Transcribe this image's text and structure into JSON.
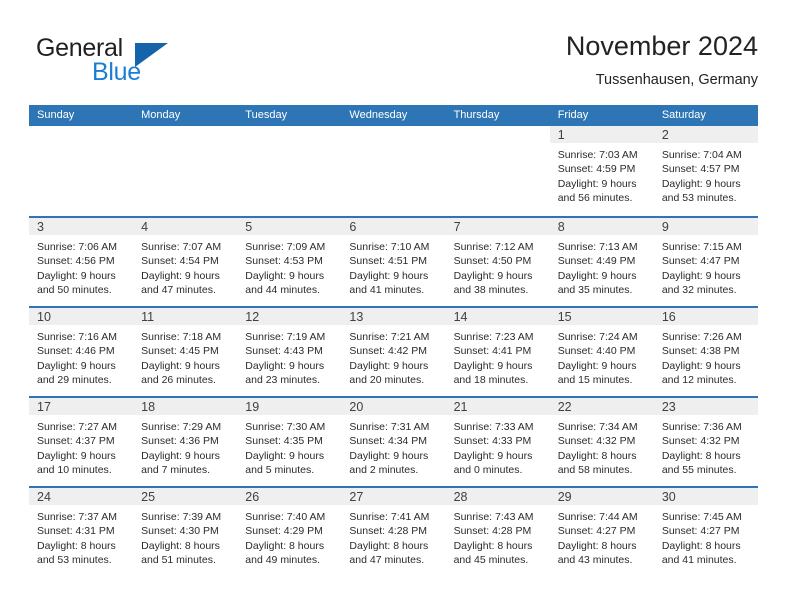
{
  "brand": {
    "word_general": "General",
    "word_blue": "Blue",
    "triangle_color": "#1464AB",
    "blue_text_color": "#1A7FD4"
  },
  "header": {
    "title": "November 2024",
    "subtitle": "Tussenhausen, Germany"
  },
  "theme": {
    "header_bg": "#2E75B6",
    "header_text": "#FFFFFF",
    "date_band_bg": "#EFEFEF",
    "row_divider": "#2E75B6",
    "body_text": "#2B2B2B"
  },
  "weekdays": [
    "Sunday",
    "Monday",
    "Tuesday",
    "Wednesday",
    "Thursday",
    "Friday",
    "Saturday"
  ],
  "weeks": [
    [
      {
        "empty": true
      },
      {
        "empty": true
      },
      {
        "empty": true
      },
      {
        "empty": true
      },
      {
        "empty": true
      },
      {
        "day": "1",
        "sunrise": "Sunrise: 7:03 AM",
        "sunset": "Sunset: 4:59 PM",
        "daylight1": "Daylight: 9 hours",
        "daylight2": "and 56 minutes."
      },
      {
        "day": "2",
        "sunrise": "Sunrise: 7:04 AM",
        "sunset": "Sunset: 4:57 PM",
        "daylight1": "Daylight: 9 hours",
        "daylight2": "and 53 minutes."
      }
    ],
    [
      {
        "day": "3",
        "sunrise": "Sunrise: 7:06 AM",
        "sunset": "Sunset: 4:56 PM",
        "daylight1": "Daylight: 9 hours",
        "daylight2": "and 50 minutes."
      },
      {
        "day": "4",
        "sunrise": "Sunrise: 7:07 AM",
        "sunset": "Sunset: 4:54 PM",
        "daylight1": "Daylight: 9 hours",
        "daylight2": "and 47 minutes."
      },
      {
        "day": "5",
        "sunrise": "Sunrise: 7:09 AM",
        "sunset": "Sunset: 4:53 PM",
        "daylight1": "Daylight: 9 hours",
        "daylight2": "and 44 minutes."
      },
      {
        "day": "6",
        "sunrise": "Sunrise: 7:10 AM",
        "sunset": "Sunset: 4:51 PM",
        "daylight1": "Daylight: 9 hours",
        "daylight2": "and 41 minutes."
      },
      {
        "day": "7",
        "sunrise": "Sunrise: 7:12 AM",
        "sunset": "Sunset: 4:50 PM",
        "daylight1": "Daylight: 9 hours",
        "daylight2": "and 38 minutes."
      },
      {
        "day": "8",
        "sunrise": "Sunrise: 7:13 AM",
        "sunset": "Sunset: 4:49 PM",
        "daylight1": "Daylight: 9 hours",
        "daylight2": "and 35 minutes."
      },
      {
        "day": "9",
        "sunrise": "Sunrise: 7:15 AM",
        "sunset": "Sunset: 4:47 PM",
        "daylight1": "Daylight: 9 hours",
        "daylight2": "and 32 minutes."
      }
    ],
    [
      {
        "day": "10",
        "sunrise": "Sunrise: 7:16 AM",
        "sunset": "Sunset: 4:46 PM",
        "daylight1": "Daylight: 9 hours",
        "daylight2": "and 29 minutes."
      },
      {
        "day": "11",
        "sunrise": "Sunrise: 7:18 AM",
        "sunset": "Sunset: 4:45 PM",
        "daylight1": "Daylight: 9 hours",
        "daylight2": "and 26 minutes."
      },
      {
        "day": "12",
        "sunrise": "Sunrise: 7:19 AM",
        "sunset": "Sunset: 4:43 PM",
        "daylight1": "Daylight: 9 hours",
        "daylight2": "and 23 minutes."
      },
      {
        "day": "13",
        "sunrise": "Sunrise: 7:21 AM",
        "sunset": "Sunset: 4:42 PM",
        "daylight1": "Daylight: 9 hours",
        "daylight2": "and 20 minutes."
      },
      {
        "day": "14",
        "sunrise": "Sunrise: 7:23 AM",
        "sunset": "Sunset: 4:41 PM",
        "daylight1": "Daylight: 9 hours",
        "daylight2": "and 18 minutes."
      },
      {
        "day": "15",
        "sunrise": "Sunrise: 7:24 AM",
        "sunset": "Sunset: 4:40 PM",
        "daylight1": "Daylight: 9 hours",
        "daylight2": "and 15 minutes."
      },
      {
        "day": "16",
        "sunrise": "Sunrise: 7:26 AM",
        "sunset": "Sunset: 4:38 PM",
        "daylight1": "Daylight: 9 hours",
        "daylight2": "and 12 minutes."
      }
    ],
    [
      {
        "day": "17",
        "sunrise": "Sunrise: 7:27 AM",
        "sunset": "Sunset: 4:37 PM",
        "daylight1": "Daylight: 9 hours",
        "daylight2": "and 10 minutes."
      },
      {
        "day": "18",
        "sunrise": "Sunrise: 7:29 AM",
        "sunset": "Sunset: 4:36 PM",
        "daylight1": "Daylight: 9 hours",
        "daylight2": "and 7 minutes."
      },
      {
        "day": "19",
        "sunrise": "Sunrise: 7:30 AM",
        "sunset": "Sunset: 4:35 PM",
        "daylight1": "Daylight: 9 hours",
        "daylight2": "and 5 minutes."
      },
      {
        "day": "20",
        "sunrise": "Sunrise: 7:31 AM",
        "sunset": "Sunset: 4:34 PM",
        "daylight1": "Daylight: 9 hours",
        "daylight2": "and 2 minutes."
      },
      {
        "day": "21",
        "sunrise": "Sunrise: 7:33 AM",
        "sunset": "Sunset: 4:33 PM",
        "daylight1": "Daylight: 9 hours",
        "daylight2": "and 0 minutes."
      },
      {
        "day": "22",
        "sunrise": "Sunrise: 7:34 AM",
        "sunset": "Sunset: 4:32 PM",
        "daylight1": "Daylight: 8 hours",
        "daylight2": "and 58 minutes."
      },
      {
        "day": "23",
        "sunrise": "Sunrise: 7:36 AM",
        "sunset": "Sunset: 4:32 PM",
        "daylight1": "Daylight: 8 hours",
        "daylight2": "and 55 minutes."
      }
    ],
    [
      {
        "day": "24",
        "sunrise": "Sunrise: 7:37 AM",
        "sunset": "Sunset: 4:31 PM",
        "daylight1": "Daylight: 8 hours",
        "daylight2": "and 53 minutes."
      },
      {
        "day": "25",
        "sunrise": "Sunrise: 7:39 AM",
        "sunset": "Sunset: 4:30 PM",
        "daylight1": "Daylight: 8 hours",
        "daylight2": "and 51 minutes."
      },
      {
        "day": "26",
        "sunrise": "Sunrise: 7:40 AM",
        "sunset": "Sunset: 4:29 PM",
        "daylight1": "Daylight: 8 hours",
        "daylight2": "and 49 minutes."
      },
      {
        "day": "27",
        "sunrise": "Sunrise: 7:41 AM",
        "sunset": "Sunset: 4:28 PM",
        "daylight1": "Daylight: 8 hours",
        "daylight2": "and 47 minutes."
      },
      {
        "day": "28",
        "sunrise": "Sunrise: 7:43 AM",
        "sunset": "Sunset: 4:28 PM",
        "daylight1": "Daylight: 8 hours",
        "daylight2": "and 45 minutes."
      },
      {
        "day": "29",
        "sunrise": "Sunrise: 7:44 AM",
        "sunset": "Sunset: 4:27 PM",
        "daylight1": "Daylight: 8 hours",
        "daylight2": "and 43 minutes."
      },
      {
        "day": "30",
        "sunrise": "Sunrise: 7:45 AM",
        "sunset": "Sunset: 4:27 PM",
        "daylight1": "Daylight: 8 hours",
        "daylight2": "and 41 minutes."
      }
    ]
  ]
}
